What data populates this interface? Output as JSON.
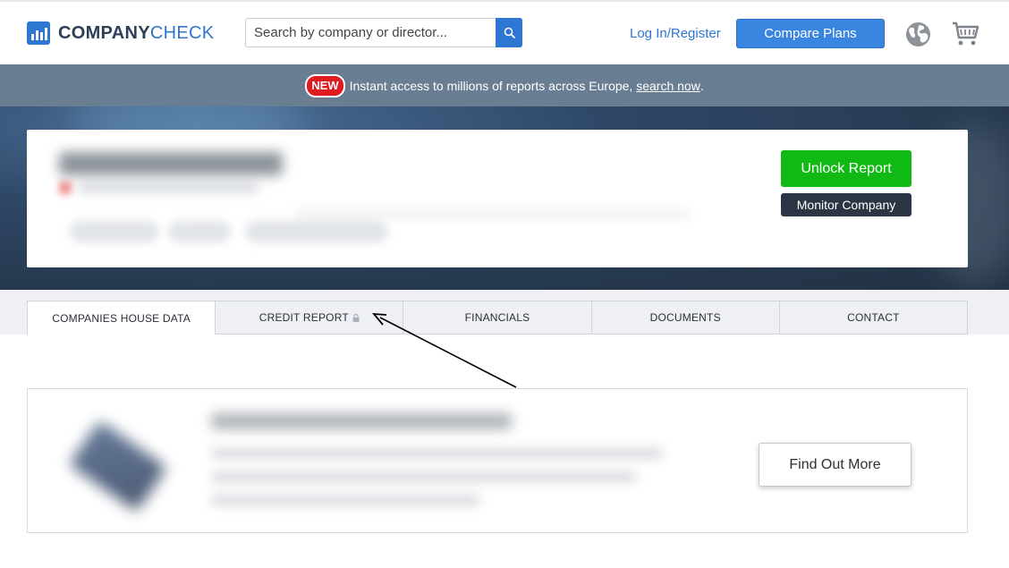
{
  "header": {
    "logo_bold": "COMPANY",
    "logo_light": "CHECK",
    "search_placeholder": "Search by company or director...",
    "login_label": "Log In/Register",
    "compare_label": "Compare Plans"
  },
  "banner": {
    "badge": "NEW",
    "text": "Instant access to millions of reports across Europe,",
    "link": "search now",
    "end": "."
  },
  "company_card": {
    "unlock_label": "Unlock Report",
    "monitor_label": "Monitor Company"
  },
  "tabs": [
    {
      "label": "COMPANIES HOUSE DATA",
      "active": true
    },
    {
      "label": "CREDIT REPORT",
      "locked": true
    },
    {
      "label": "FINANCIALS"
    },
    {
      "label": "DOCUMENTS"
    },
    {
      "label": "CONTACT"
    }
  ],
  "promo": {
    "button_label": "Find Out More"
  },
  "colors": {
    "brand_blue": "#2d76d2",
    "green": "#10b913",
    "banner_bg": "#6a7e93",
    "badge_red": "#e01b22"
  }
}
